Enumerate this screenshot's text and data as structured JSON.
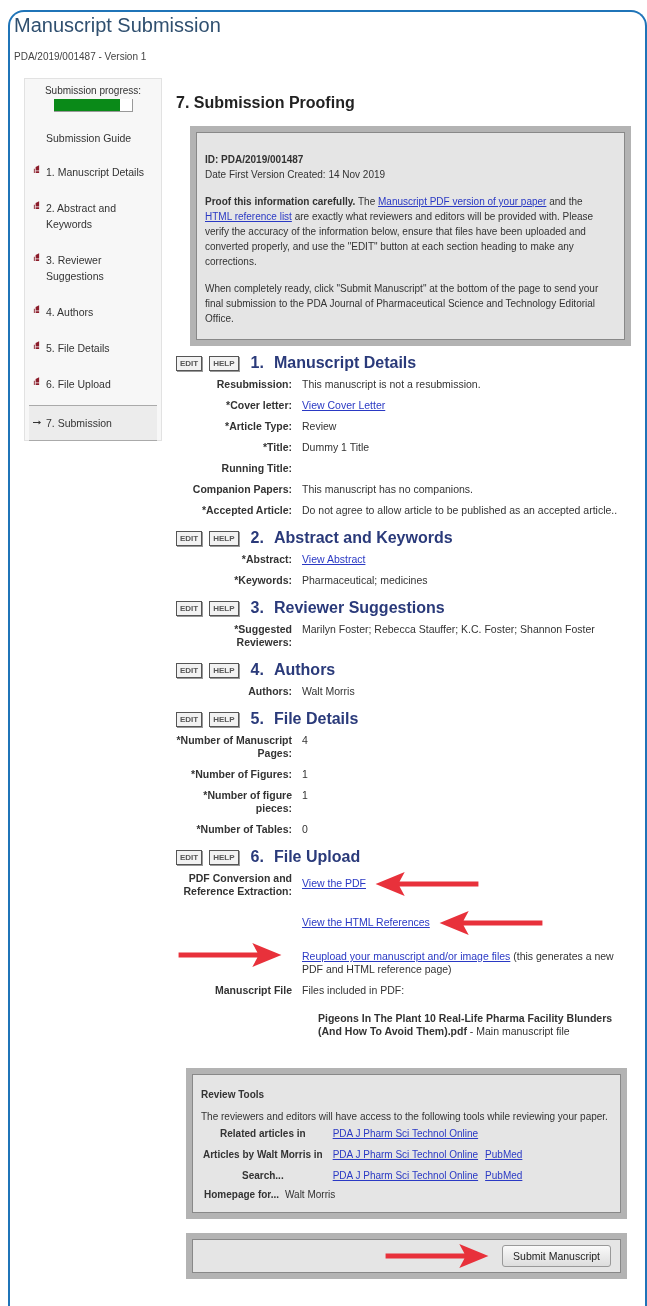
{
  "header": {
    "title": "Manuscript Submission",
    "reference": "PDA/2019/001487 - Version 1"
  },
  "sidebar": {
    "progress_label": "Submission progress:",
    "progress": {
      "level": 0.85
    },
    "guide_label": "Submission Guide",
    "items": [
      {
        "label": "1. Manuscript Details",
        "completed": true,
        "selected": false
      },
      {
        "label": "2. Abstract and Keywords",
        "completed": true,
        "selected": false
      },
      {
        "label": "3. Reviewer Suggestions",
        "completed": true,
        "selected": false
      },
      {
        "label": "4. Authors",
        "completed": true,
        "selected": false
      },
      {
        "label": "5. File Details",
        "completed": true,
        "selected": false
      },
      {
        "label": "6. File Upload",
        "completed": true,
        "selected": false
      },
      {
        "label": "7. Submission",
        "completed": false,
        "selected": true
      }
    ]
  },
  "page_heading": "7. Submission Proofing",
  "info_box": {
    "id_line": "ID: PDA/2019/001487",
    "date_line": "Date First Version Created: 14 Nov 2019",
    "paragraphs": [
      [
        {
          "kind": "bold",
          "text": "Proof this information carefully."
        },
        {
          "kind": "text",
          "text": " The "
        },
        {
          "kind": "link",
          "text": "Manuscript PDF version of your paper"
        },
        {
          "kind": "text",
          "text": " and the "
        },
        {
          "kind": "link",
          "text": "HTML reference list"
        },
        {
          "kind": "text",
          "text": " are exactly what reviewers and editors will be provided with. Please verify the accuracy of the information below, ensure that files have been uploaded and converted properly, and use the \"EDIT\" button at each section heading to make any corrections."
        }
      ],
      [
        {
          "kind": "text",
          "text": "When completely ready, click \"Submit Manuscript\" at the bottom of the page to send your final submission to the PDA Journal of Pharmaceutical Science and Technology Editorial Office."
        }
      ]
    ]
  },
  "sections": [
    {
      "buttons": [
        "EDIT",
        "HELP"
      ],
      "number": "1.",
      "title": "Manuscript Details",
      "fields": [
        {
          "label": "Resubmission:",
          "lines": [
            {
              "segments": [
                {
                  "kind": "text",
                  "text": "This manuscript is not a resubmission."
                }
              ]
            }
          ]
        },
        {
          "label": "*Cover letter:",
          "lines": [
            {
              "segments": [
                {
                  "kind": "link",
                  "text": "View Cover Letter"
                }
              ]
            }
          ]
        },
        {
          "label": "*Article Type:",
          "lines": [
            {
              "segments": [
                {
                  "kind": "text",
                  "text": "Review"
                }
              ]
            }
          ]
        },
        {
          "label": "*Title:",
          "lines": [
            {
              "segments": [
                {
                  "kind": "text",
                  "text": "Dummy 1 Title"
                }
              ]
            }
          ]
        },
        {
          "label": "Running Title:"
        },
        {
          "label": "Companion Papers:",
          "lines": [
            {
              "segments": [
                {
                  "kind": "text",
                  "text": "This manuscript has no companions."
                }
              ]
            }
          ]
        },
        {
          "label": "*Accepted Article:",
          "lines": [
            {
              "segments": [
                {
                  "kind": "text",
                  "text": "Do not agree to allow article to be published as an accepted article.."
                }
              ]
            }
          ]
        }
      ]
    },
    {
      "buttons": [
        "EDIT",
        "HELP"
      ],
      "number": "2.",
      "title": "Abstract and Keywords",
      "fields": [
        {
          "label": "*Abstract:",
          "lines": [
            {
              "segments": [
                {
                  "kind": "link",
                  "text": "View Abstract"
                }
              ]
            }
          ]
        },
        {
          "label": "*Keywords:",
          "lines": [
            {
              "segments": [
                {
                  "kind": "text",
                  "text": "Pharmaceutical; medicines"
                }
              ]
            }
          ]
        }
      ]
    },
    {
      "buttons": [
        "EDIT",
        "HELP"
      ],
      "number": "3.",
      "title": "Reviewer Suggestions",
      "fields": [
        {
          "label": "*Suggested Reviewers:",
          "lines": [
            {
              "segments": [
                {
                  "kind": "text",
                  "text": "Marilyn Foster; Rebecca Stauffer; K.C. Foster; Shannon Foster"
                }
              ]
            }
          ]
        }
      ]
    },
    {
      "buttons": [
        "EDIT",
        "HELP"
      ],
      "number": "4.",
      "title": "Authors",
      "fields": [
        {
          "label": "Authors:",
          "lines": [
            {
              "segments": [
                {
                  "kind": "text",
                  "text": "Walt Morris"
                }
              ]
            }
          ]
        }
      ]
    },
    {
      "buttons": [
        "EDIT",
        "HELP"
      ],
      "number": "5.",
      "title": "File Details",
      "fields": [
        {
          "label": "*Number of Manuscript Pages:",
          "lines": [
            {
              "segments": [
                {
                  "kind": "text",
                  "text": "4"
                }
              ]
            }
          ]
        },
        {
          "label": "*Number of Figures:",
          "lines": [
            {
              "segments": [
                {
                  "kind": "text",
                  "text": "1"
                }
              ]
            }
          ]
        },
        {
          "label": "*Number of figure pieces:",
          "lines": [
            {
              "segments": [
                {
                  "kind": "text",
                  "text": "1"
                }
              ]
            }
          ]
        },
        {
          "label": "*Number of Tables:",
          "lines": [
            {
              "segments": [
                {
                  "kind": "text",
                  "text": "0"
                }
              ]
            }
          ]
        }
      ]
    },
    {
      "buttons": [
        "EDIT",
        "HELP"
      ],
      "number": "6.",
      "title": "File Upload",
      "fields": [
        {
          "label": "PDF Conversion and Reference Extraction:",
          "lines": [
            {
              "segments": [
                {
                  "kind": "link",
                  "text": "View the PDF",
                  "annotation": {
                    "kind": "arrow_left_after"
                  }
                }
              ]
            },
            {
              "segments": [
                {
                  "kind": "link",
                  "text": "View the HTML References",
                  "annotation": {
                    "kind": "arrow_left_after"
                  }
                }
              ]
            },
            {
              "segments": [
                {
                  "kind": "link",
                  "text": "Reupload your manuscript and/or image files",
                  "annotation": {
                    "kind": "arrow_right_before"
                  }
                },
                {
                  "kind": "text",
                  "text": " (this generates a new PDF and HTML reference page)"
                }
              ]
            }
          ]
        },
        {
          "label": "Manuscript File",
          "lines": [
            {
              "segments": [
                {
                  "kind": "text",
                  "text": "Files included in PDF:"
                }
              ]
            },
            {
              "indented": true,
              "segments": [
                {
                  "kind": "bold",
                  "text": "Pigeons In The Plant 10 Real-Life Pharma Facility Blunders (And How To Avoid Them).pdf"
                },
                {
                  "kind": "text",
                  "text": " - Main manuscript file"
                }
              ]
            }
          ]
        }
      ]
    }
  ],
  "review_tools": {
    "title": "Review Tools",
    "description": "The reviewers and editors will have access to the following tools while reviewing your paper.",
    "rows": [
      {
        "label": "Related articles in",
        "links": [
          "PDA J Pharm Sci Technol Online"
        ]
      },
      {
        "label": "Articles by Walt Morris in",
        "links": [
          "PDA J Pharm Sci Technol Online",
          "PubMed"
        ]
      },
      {
        "label": "Search...",
        "links": [
          "PDA J Pharm Sci Technol Online",
          "PubMed"
        ]
      }
    ],
    "homepage_label": "Homepage for...",
    "homepage_value": "Walt Morris"
  },
  "submit": {
    "button": "Submit Manuscript",
    "annotation": {
      "kind": "arrow_right_before"
    }
  }
}
